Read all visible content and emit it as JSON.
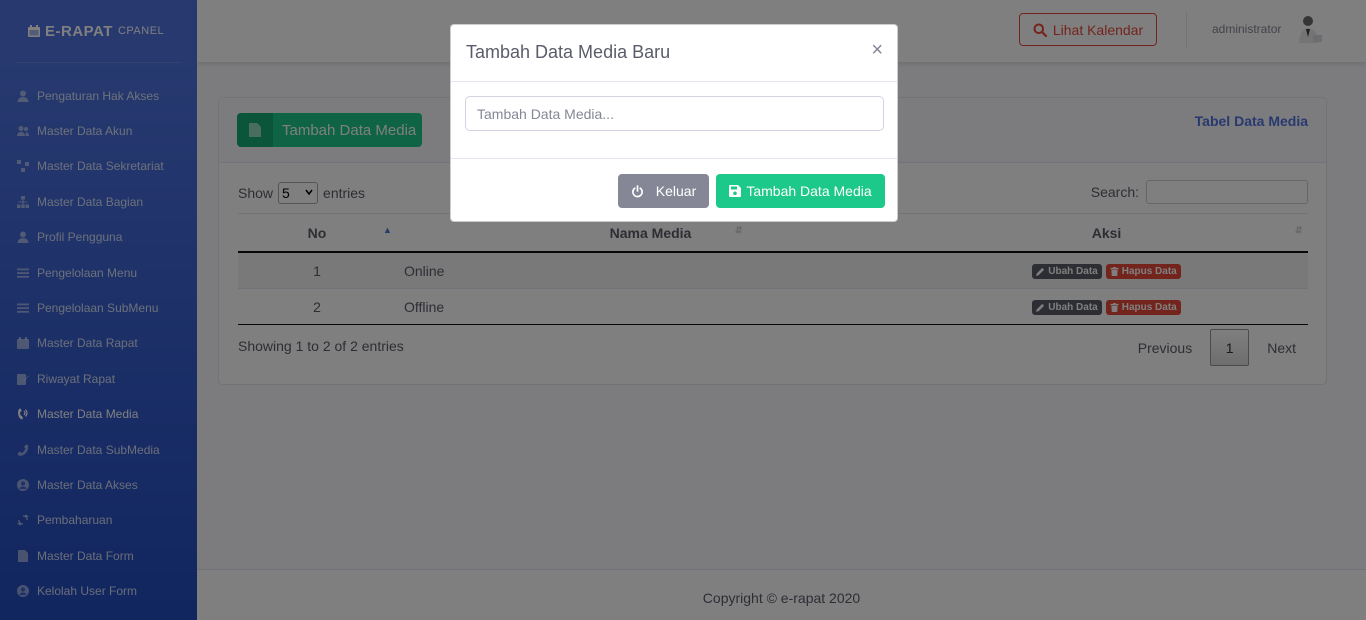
{
  "brand": {
    "name": "E-RAPAT",
    "suffix": "CPANEL"
  },
  "sidebar": {
    "items": [
      {
        "label": "Pengaturan Hak Akses",
        "icon": "user-icon"
      },
      {
        "label": "Master Data Akun",
        "icon": "users-icon"
      },
      {
        "label": "Master Data Sekretariat",
        "icon": "network-icon"
      },
      {
        "label": "Master Data Bagian",
        "icon": "sitemap-icon"
      },
      {
        "label": "Profil Pengguna",
        "icon": "user-icon"
      },
      {
        "label": "Pengelolaan Menu",
        "icon": "bars-icon"
      },
      {
        "label": "Pengelolaan SubMenu",
        "icon": "bars-icon"
      },
      {
        "label": "Master Data Rapat",
        "icon": "calendar-icon"
      },
      {
        "label": "Riwayat Rapat",
        "icon": "edit-icon"
      },
      {
        "label": "Master Data Media",
        "icon": "phone-volume-icon",
        "active": true
      },
      {
        "label": "Master Data SubMedia",
        "icon": "phone-icon"
      },
      {
        "label": "Master Data Akses",
        "icon": "user-circle-icon"
      },
      {
        "label": "Pembaharuan",
        "icon": "sync-icon"
      },
      {
        "label": "Master Data Form",
        "icon": "file-icon"
      },
      {
        "label": "Kelolah User Form",
        "icon": "user-circle-icon"
      }
    ]
  },
  "topbar": {
    "calendar_button": "Lihat Kalendar",
    "username": "administrator"
  },
  "card": {
    "add_button": "Tambah Data Media",
    "title": "Tabel Data Media"
  },
  "table": {
    "show_label": "Show",
    "page_size": "5",
    "entries_label": "entries",
    "search_label": "Search:",
    "columns": [
      "No",
      "Nama Media",
      "Aksi"
    ],
    "rows": [
      {
        "no": "1",
        "nama": "Online",
        "edit": "Ubah Data",
        "delete": "Hapus Data"
      },
      {
        "no": "2",
        "nama": "Offline",
        "edit": "Ubah Data",
        "delete": "Hapus Data"
      }
    ],
    "info": "Showing 1 to 2 of 2 entries",
    "pagination": {
      "previous": "Previous",
      "current": "1",
      "next": "Next"
    }
  },
  "footer": {
    "copyright": "Copyright © e-rapat 2020"
  },
  "modal": {
    "title": "Tambah Data Media Baru",
    "close": "×",
    "input_placeholder": "Tambah Data Media...",
    "input_value": "",
    "cancel_button": "Keluar",
    "save_button": "Tambah Data Media"
  },
  "colors": {
    "primary": "#4e73df",
    "success": "#1cc88a",
    "danger": "#e74a3b",
    "secondary": "#858796"
  }
}
